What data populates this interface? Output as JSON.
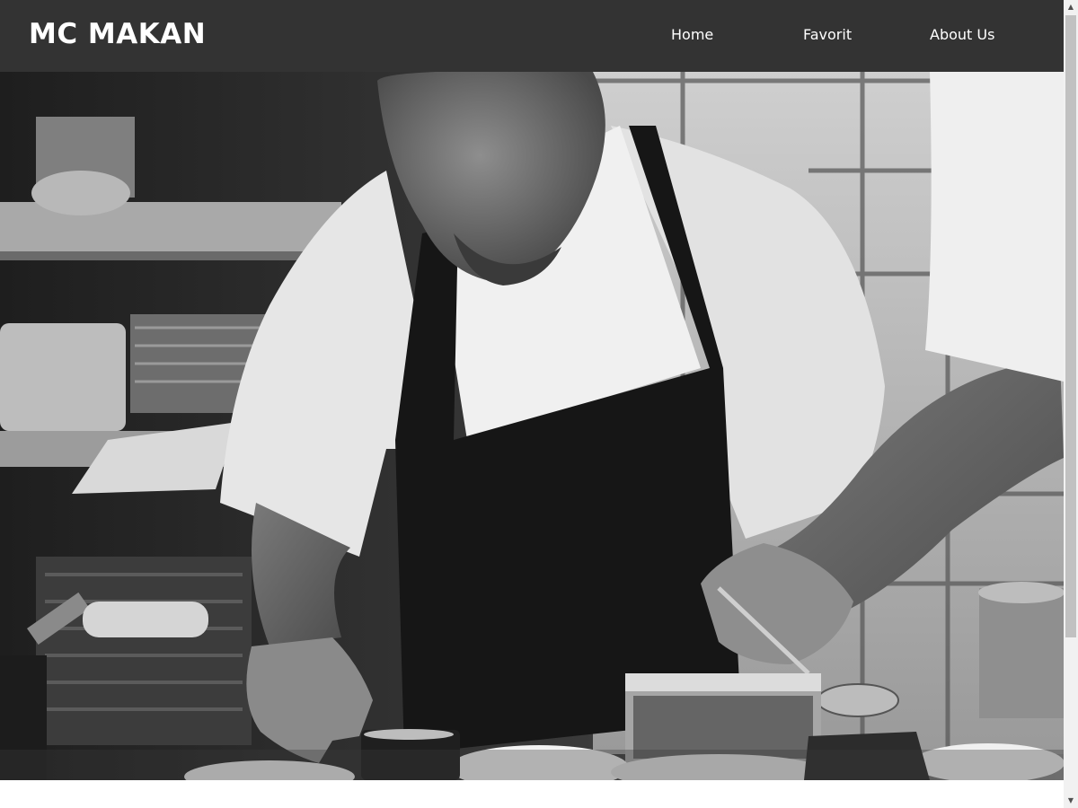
{
  "navbar": {
    "brand": "MC MAKAN",
    "links": [
      {
        "label": "Home"
      },
      {
        "label": "Favorit"
      },
      {
        "label": "About Us"
      }
    ]
  },
  "hero": {
    "image_subject": "chef-plating-food-photo",
    "style": "black-and-white"
  },
  "scrollbar": {
    "up_icon": "▲",
    "down_icon": "▼"
  },
  "colors": {
    "navbar_bg": "#333333",
    "nav_text": "#ffffff",
    "page_bg": "#ffffff"
  }
}
